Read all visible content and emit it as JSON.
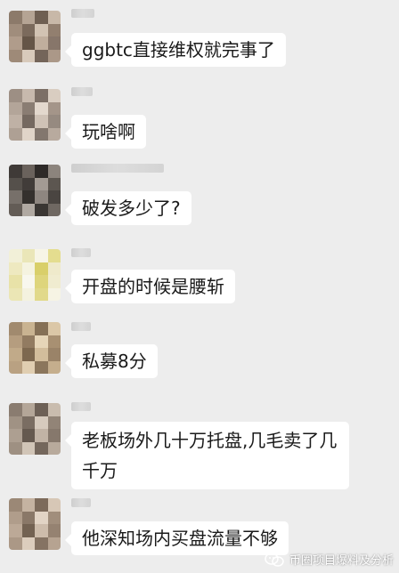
{
  "messages": [
    {
      "text": "ggbtc直接维权就完事了",
      "avatar_colors": [
        "#8c7a6a",
        "#b5a494",
        "#6f5f52",
        "#c8b8a8",
        "#a08d7c",
        "#7b6a5c",
        "#d2c3b3",
        "#927f6f",
        "#b09c8b",
        "#655547",
        "#c0ae9d",
        "#87766a",
        "#9e8a78",
        "#d8cabb",
        "#74655a",
        "#ab9888"
      ]
    },
    {
      "text": "玩啥啊",
      "avatar_colors": [
        "#9d8f84",
        "#c7b9ad",
        "#7c6f66",
        "#d9cdc1",
        "#b3a599",
        "#8a7d73",
        "#e3d8cd",
        "#a49589",
        "#bfb1a5",
        "#756960",
        "#cfc2b6",
        "#968a80",
        "#aea094",
        "#e0d4c8",
        "#83776e",
        "#b8aa9e"
      ]
    },
    {
      "text": "破发多少了?",
      "avatar_colors": [
        "#3f3a37",
        "#6a625c",
        "#2e2a28",
        "#8c847d",
        "#55504b",
        "#413c39",
        "#a39b94",
        "#5c5650",
        "#77706a",
        "#34302d",
        "#8e8680",
        "#4a4541",
        "#635c56",
        "#b0a9a2",
        "#3a3633",
        "#6f6862"
      ]
    },
    {
      "text": "开盘的时候是腰斩",
      "avatar_colors": [
        "#f2f0d8",
        "#eae6b8",
        "#f7f5e6",
        "#e4dd8f",
        "#eee9c0",
        "#f5f3e0",
        "#d9cf6a",
        "#efeacb",
        "#e8e2a8",
        "#f8f7ee",
        "#ded57c",
        "#f0ecd0",
        "#ebe6b5",
        "#f4f2df",
        "#e1d98a",
        "#f6f4e4"
      ]
    },
    {
      "text": "私募8分",
      "avatar_colors": [
        "#a18a6e",
        "#c9b391",
        "#857056",
        "#dbc7a7",
        "#b59d7f",
        "#927b61",
        "#e6d5b8",
        "#a89072",
        "#c1aa89",
        "#7d684f",
        "#d2bd9c",
        "#9a8368",
        "#b9a182",
        "#e0ceb1",
        "#8b765c",
        "#c5ae8d"
      ]
    },
    {
      "text": "老板场外几十万托盘,几毛卖了几千万",
      "avatar_colors": [
        "#8a7c70",
        "#b4a698",
        "#6d6056",
        "#c9bcae",
        "#a09284",
        "#7a6d62",
        "#d6cabd",
        "#928477",
        "#ad9f91",
        "#65594f",
        "#c1b3a5",
        "#86786c",
        "#9e9082",
        "#d1c5b7",
        "#74675c",
        "#b8aa9c"
      ]
    },
    {
      "text": "他深知场内买盘流量不够",
      "avatar_colors": [
        "#9b8876",
        "#c5b3a1",
        "#7d6b5b",
        "#d7c7b6",
        "#b09d8b",
        "#8a7868",
        "#e2d4c5",
        "#a18e7c",
        "#bca997",
        "#736252",
        "#cdbcab",
        "#958271",
        "#ab9886",
        "#dccdbd",
        "#857363",
        "#b6a391"
      ]
    }
  ],
  "watermark": {
    "text": "币圈项目爆料及分析",
    "icon": "wechat-official-account-icon"
  }
}
